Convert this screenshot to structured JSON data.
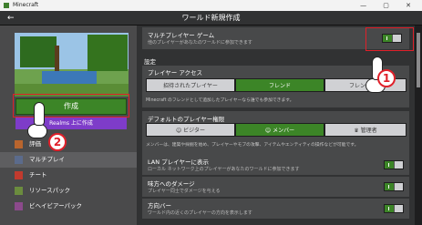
{
  "window": {
    "title": "Minecraft"
  },
  "header": {
    "title": "ワールド新規作成",
    "back_icon": "arrow-left-icon"
  },
  "left": {
    "create_label": "作成",
    "realms_label": "Realms 上に作成",
    "nav": [
      {
        "label": "評価",
        "icon": "pickaxe-icon",
        "color": "#b9652e"
      },
      {
        "label": "マルチプレイ",
        "icon": "multiplayer-icon",
        "color": "#5b6b8c"
      },
      {
        "label": "チート",
        "icon": "cheat-icon",
        "color": "#c23a2e"
      },
      {
        "label": "リソースパック",
        "icon": "resource-pack-icon",
        "color": "#6b8c3e"
      },
      {
        "label": "ビヘイビアーパック",
        "icon": "behavior-pack-icon",
        "color": "#8c4a8c"
      }
    ]
  },
  "right": {
    "multiplayer": {
      "title": "マルチプレイヤー ゲーム",
      "desc": "他のプレイヤーがあなたのワールドに参加できます"
    },
    "settings_label": "設定",
    "access": {
      "title": "プレイヤー アクセス",
      "options": [
        "招待されたプレイヤー",
        "フレンド",
        "フレンドのフ"
      ],
      "selected": 1,
      "note": "Minecraft のフレンドとして追加したプレイヤーなら誰でも参加できます。"
    },
    "permission": {
      "title": "デフォルトのプレイヤー権限",
      "options": [
        "ビジター",
        "メンバー",
        "管理者"
      ],
      "selected": 1,
      "note": "メンバーは、建築や採掘を始め、プレイヤーやモブの攻撃、アイテムやエンティティの操作などが可能です。"
    },
    "lan": {
      "title": "LAN プレイヤーに表示",
      "desc": "ローカル ネットワーク上のプレイヤーがあなたのワールドに参加できます"
    },
    "friendly_fire": {
      "title": "味方へのダメージ",
      "desc": "プレイヤー同士でダメージを与える"
    },
    "direction_bar": {
      "title": "方向バー",
      "desc": "ワールド内の近くのプレイヤーの方向を表示します"
    }
  },
  "annotations": {
    "badge1": "1",
    "badge2": "2"
  },
  "colors": {
    "accent_green": "#3c8527",
    "highlight_red": "#e0202a",
    "realms_purple": "#7e3cc9"
  }
}
